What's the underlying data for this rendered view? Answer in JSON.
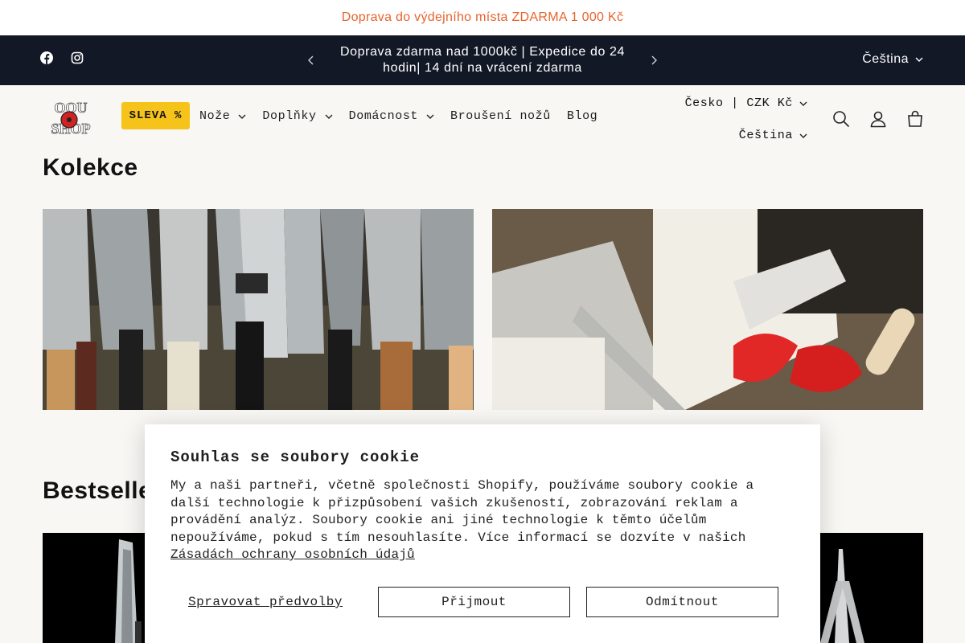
{
  "promo": {
    "text": " Doprava do výdejního místa ZDARMA 1 000 Kč",
    "color": "#e8632c"
  },
  "announcement": {
    "text": "Doprava zdarma nad 1000kč | Expedice do 24 hodin| 14 dní na vrácení zdarma",
    "language": "Čeština",
    "social": [
      "facebook-icon",
      "instagram-icon"
    ]
  },
  "header": {
    "sale_label": "SLEVA %",
    "nav": [
      {
        "label": "Nože",
        "dropdown": true
      },
      {
        "label": "Doplňky",
        "dropdown": true
      },
      {
        "label": "Domácnost",
        "dropdown": true
      },
      {
        "label": "Broušení nožů",
        "dropdown": false
      },
      {
        "label": "Blog",
        "dropdown": false
      }
    ],
    "country": "Česko | CZK Kč",
    "language": "Čeština",
    "icons": [
      "search-icon",
      "account-icon",
      "cart-icon"
    ]
  },
  "main": {
    "collections_heading": "Kolekce",
    "bestsellers_heading": "Bestselle"
  },
  "cookie": {
    "title": "Souhlas se soubory cookie",
    "body": "My a naši partneři, včetně společnosti Shopify, používáme soubory cookie a další technologie k přizpůsobení vašich zkušeností, zobrazování reklam a provádění analýz. Soubory cookie ani jiné technologie k těmto účelům nepoužíváme, pokud s tím nesouhlasíte. Více informací se dozvíte v našich",
    "link": "Zásadách ochrany osobních údajů",
    "manage": "Spravovat předvolby",
    "accept": "Přijmout",
    "decline": "Odmítnout"
  },
  "colors": {
    "dark_bar": "#121826",
    "sale": "#f6c31b"
  }
}
